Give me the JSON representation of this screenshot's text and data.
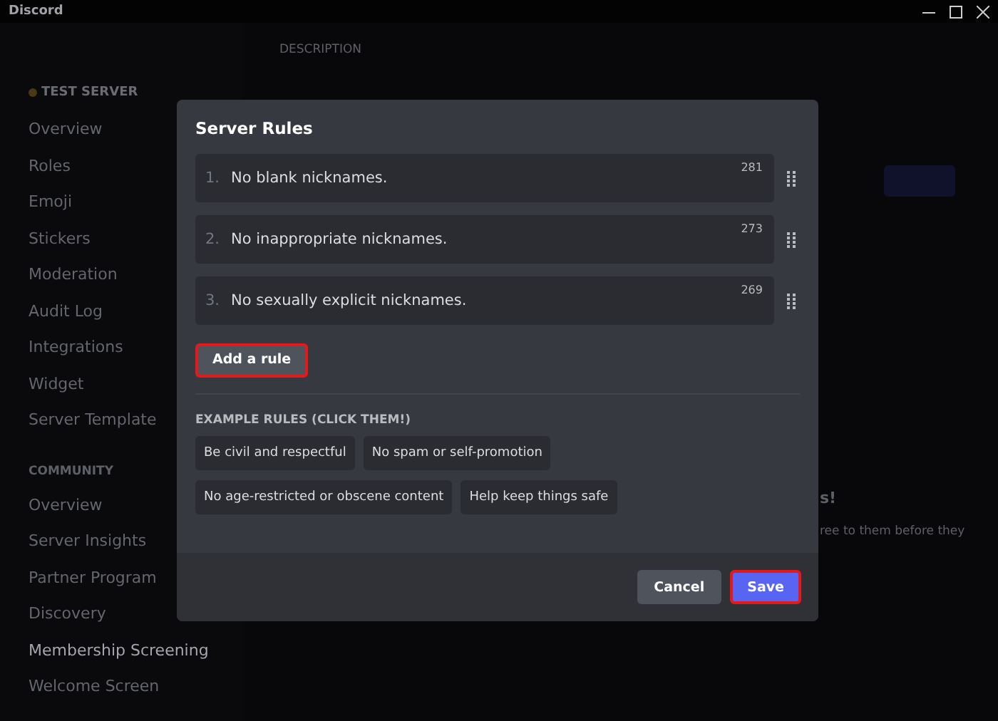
{
  "window": {
    "title": "Discord"
  },
  "sidebar": {
    "server_name": "TEST SERVER",
    "items": [
      {
        "label": "Overview",
        "selected": false
      },
      {
        "label": "Roles",
        "selected": false
      },
      {
        "label": "Emoji",
        "selected": false
      },
      {
        "label": "Stickers",
        "selected": false
      },
      {
        "label": "Moderation",
        "selected": false
      },
      {
        "label": "Audit Log",
        "selected": false
      },
      {
        "label": "Integrations",
        "selected": false
      },
      {
        "label": "Widget",
        "selected": false
      },
      {
        "label": "Server Template",
        "selected": false
      }
    ],
    "section": "COMMUNITY",
    "community_items": [
      {
        "label": "Overview",
        "selected": false
      },
      {
        "label": "Server Insights",
        "selected": false
      },
      {
        "label": "Partner Program",
        "selected": false
      },
      {
        "label": "Discovery",
        "selected": false
      },
      {
        "label": "Membership Screening",
        "selected": true
      },
      {
        "label": "Welcome Screen",
        "selected": false
      }
    ]
  },
  "main": {
    "description_label": "DESCRIPTION",
    "heading_fragment": "s!",
    "text_fragment": "ree to them before they"
  },
  "modal": {
    "title": "Server Rules",
    "rules": [
      {
        "number": "1.",
        "text": "No blank nicknames.",
        "remaining": "281"
      },
      {
        "number": "2.",
        "text": "No inappropriate nicknames.",
        "remaining": "273"
      },
      {
        "number": "3.",
        "text": "No sexually explicit nicknames.",
        "remaining": "269"
      }
    ],
    "add_button": {
      "label": "Add a rule",
      "highlighted": true
    },
    "examples_label": "EXAMPLE RULES (CLICK THEM!)",
    "examples": [
      {
        "label": "Be civil and respectful"
      },
      {
        "label": "No spam or self-promotion"
      },
      {
        "label": "No age-restricted or obscene content"
      },
      {
        "label": "Help keep things safe"
      }
    ],
    "cancel_button": {
      "label": "Cancel",
      "highlighted": false
    },
    "save_button": {
      "label": "Save",
      "highlighted": true
    }
  }
}
